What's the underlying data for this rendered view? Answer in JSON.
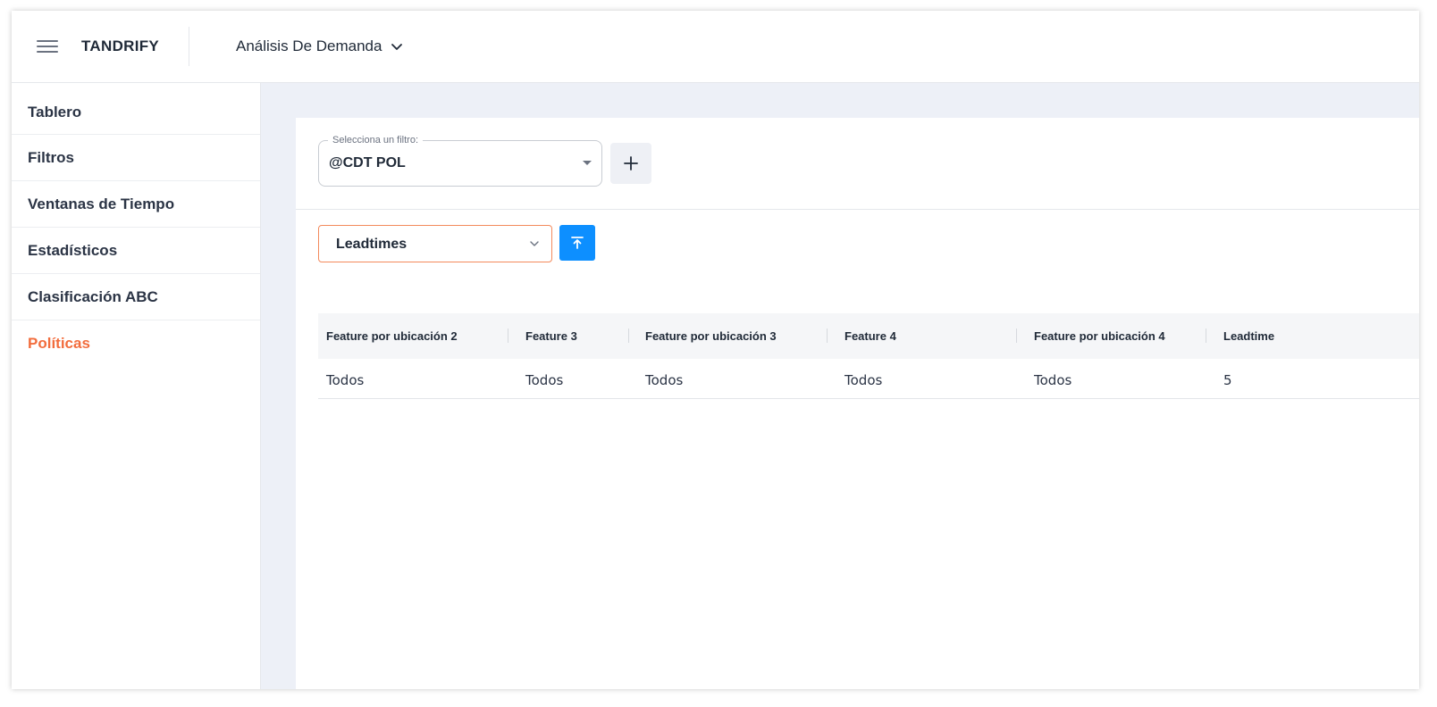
{
  "app": {
    "brand": "TANDRIFY",
    "module": "Análisis De Demanda"
  },
  "sidebar": {
    "items": [
      {
        "label": "Tablero"
      },
      {
        "label": "Filtros"
      },
      {
        "label": "Ventanas de Tiempo"
      },
      {
        "label": "Estadísticos"
      },
      {
        "label": "Clasificación ABC"
      },
      {
        "label": "Políticas"
      }
    ],
    "active": "Políticas"
  },
  "filter": {
    "label": "Selecciona un filtro:",
    "value": "@CDT POL"
  },
  "report": {
    "value": "Leadtimes"
  },
  "table": {
    "headers": [
      "Feature por ubicación 2",
      "Feature 3",
      "Feature por ubicación 3",
      "Feature 4",
      "Feature por ubicación 4",
      "Leadtime"
    ],
    "rows": [
      [
        "Todos",
        "Todos",
        "Todos",
        "Todos",
        "Todos",
        "5"
      ]
    ]
  },
  "colors": {
    "accent": "#f26d3d",
    "primary_button": "#0d8fff",
    "background": "#edf0f7"
  },
  "icons": {
    "menu": "hamburger-icon",
    "module_dropdown": "chevron-down-icon",
    "filter_dropdown": "caret-down-icon",
    "add": "plus-icon",
    "report_dropdown": "chevron-down-icon",
    "upload": "upload-icon"
  }
}
